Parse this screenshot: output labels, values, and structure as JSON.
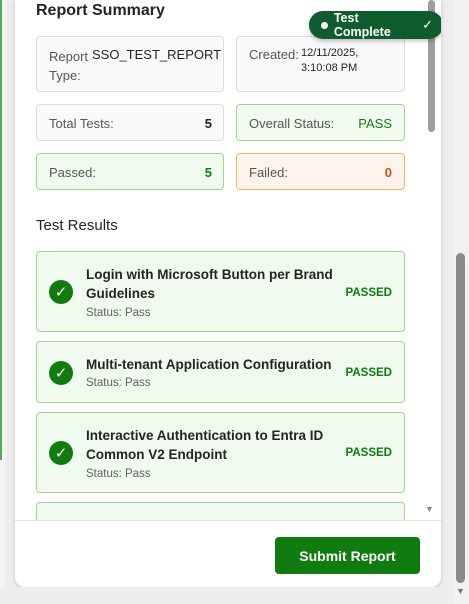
{
  "summary": {
    "title": "Report Summary",
    "report_type_label": "Report Type:",
    "report_type_value": "SSO_TEST_REPORT",
    "created_label": "Created:",
    "created_date": "12/11/2025,",
    "created_time": "3:10:08 PM",
    "total_label": "Total Tests:",
    "total_value": "5",
    "overall_label": "Overall Status:",
    "overall_value": "PASS",
    "passed_label": "Passed:",
    "passed_value": "5",
    "failed_label": "Failed:",
    "failed_value": "0"
  },
  "toast": {
    "text": "Test Complete",
    "check": "✓"
  },
  "results": {
    "title": "Test Results",
    "items": [
      {
        "title": "Login with Microsoft Button per Brand Guidelines",
        "status": "Status: Pass",
        "badge": "PASSED"
      },
      {
        "title": "Multi-tenant Application Configuration",
        "status": "Status: Pass",
        "badge": "PASSED"
      },
      {
        "title": "Interactive Authentication to Entra ID Common V2 Endpoint",
        "status": "Status: Pass",
        "badge": "PASSED"
      }
    ]
  },
  "footer": {
    "submit_label": "Submit Report"
  },
  "colors": {
    "accent": "#107c10",
    "toast_bg": "#0f5c2e",
    "failed": "#ca5010",
    "card_bg": "#f1faef"
  },
  "icons": {
    "check": "check-icon",
    "scroll_down": "scroll-down-arrow-icon"
  }
}
